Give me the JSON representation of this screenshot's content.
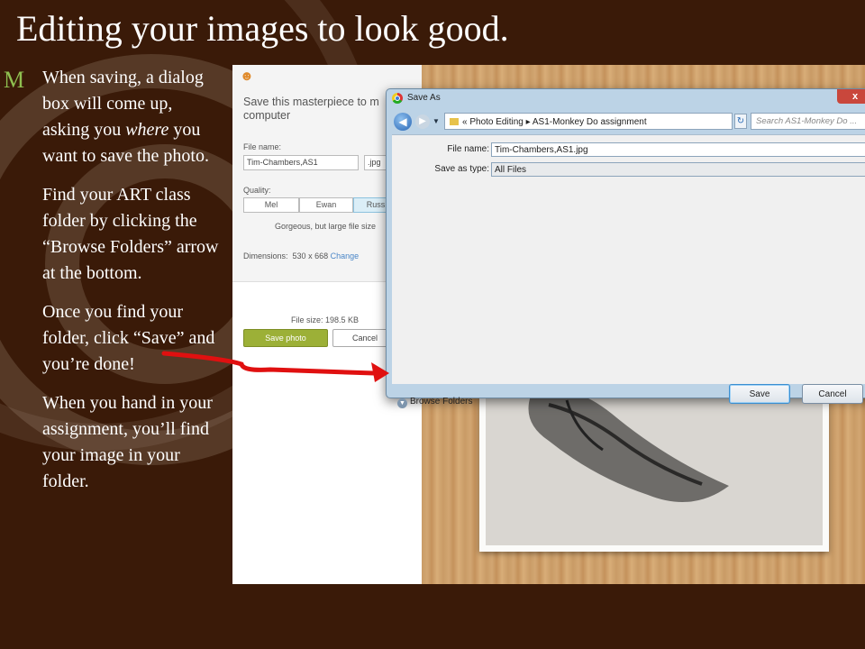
{
  "slide": {
    "title": "Editing your images to look good.",
    "bullet_marker": "M",
    "paragraphs": [
      {
        "before": "When saving, a dialog box will come up, asking you ",
        "emph": "where",
        "after": " you want to save the photo."
      },
      {
        "text": "Find your ART class folder by clicking the “Browse Folders” arrow at the bottom."
      },
      {
        "text": "Once you find your folder, click “Save” and you’re done!"
      },
      {
        "text": "When you hand in your assignment, you’ll find your image in your folder."
      }
    ]
  },
  "editor": {
    "logo_icon": "monkey-logo-icon",
    "save_heading": "Save this masterpiece to m computer",
    "file_name_label": "File name:",
    "file_name_value": "Tim-Chambers,AS1",
    "extension": ".jpg",
    "quality_label": "Quality:",
    "quality_options": [
      "Mel",
      "Ewan",
      "Russ"
    ],
    "quality_description": "Gorgeous, but large file size",
    "dimensions_label": "Dimensions:",
    "dimensions_value": "530 x 668",
    "change_link": "Change",
    "file_size": "File size: 198.5 KB",
    "save_photo_button": "Save photo",
    "cancel_button": "Cancel",
    "accent_color": "#9cb037"
  },
  "dialog": {
    "title": "Save As",
    "close_label": "x",
    "breadcrumb": [
      "«",
      "Photo Editing",
      "AS1-Monkey Do assignment"
    ],
    "search_placeholder": "Search AS1-Monkey Do ...",
    "file_name_label": "File name:",
    "file_name_value": "Tim-Chambers,AS1.jpg",
    "save_type_label": "Save as type:",
    "save_type_value": "All Files",
    "browse_folders": "Browse Folders",
    "save_button": "Save",
    "cancel_button": "Cancel"
  },
  "annotation": {
    "arrow_color": "#e01010"
  }
}
